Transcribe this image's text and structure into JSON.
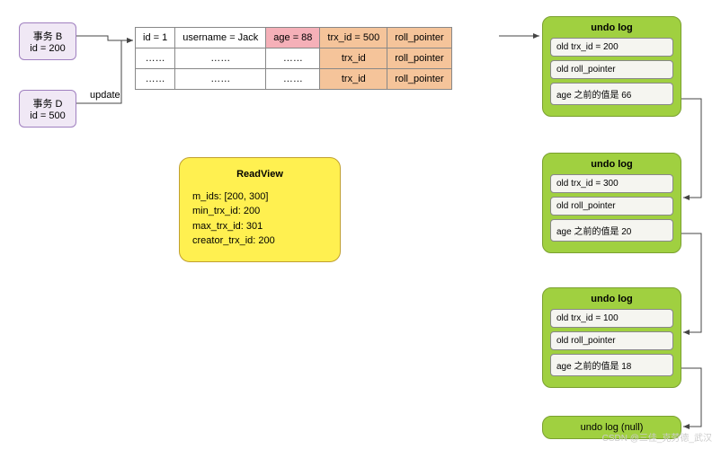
{
  "tx_b": {
    "label": "事务 B",
    "id": "id = 200"
  },
  "tx_d": {
    "label": "事务 D",
    "id": "id = 500"
  },
  "edge_update": "update",
  "table": {
    "rows": [
      {
        "id": "id = 1",
        "username": "username = Jack",
        "age": "age = 88",
        "trx": "trx_id = 500",
        "roll": "roll_pointer"
      },
      {
        "id": "……",
        "username": "……",
        "age": "……",
        "trx": "trx_id",
        "roll": "roll_pointer"
      },
      {
        "id": "……",
        "username": "……",
        "age": "……",
        "trx": "trx_id",
        "roll": "roll_pointer"
      }
    ]
  },
  "readview": {
    "title": "ReadView",
    "m_ids": "m_ids: [200, 300]",
    "min": "min_trx_id: 200",
    "max": "max_trx_id: 301",
    "creator": "creator_trx_id: 200"
  },
  "undo1": {
    "title": "undo log",
    "trx": "old trx_id = 200",
    "roll": "old roll_pointer",
    "val": "age 之前的值是 66"
  },
  "undo2": {
    "title": "undo log",
    "trx": "old trx_id = 300",
    "roll": "old roll_pointer",
    "val": "age 之前的值是 20"
  },
  "undo3": {
    "title": "undo log",
    "trx": "old trx_id = 100",
    "roll": "old roll_pointer",
    "val": "age 之前的值是 18"
  },
  "undo_null": "undo log (null)",
  "watermark": "CSDN @三佳_克劳德_武汉"
}
